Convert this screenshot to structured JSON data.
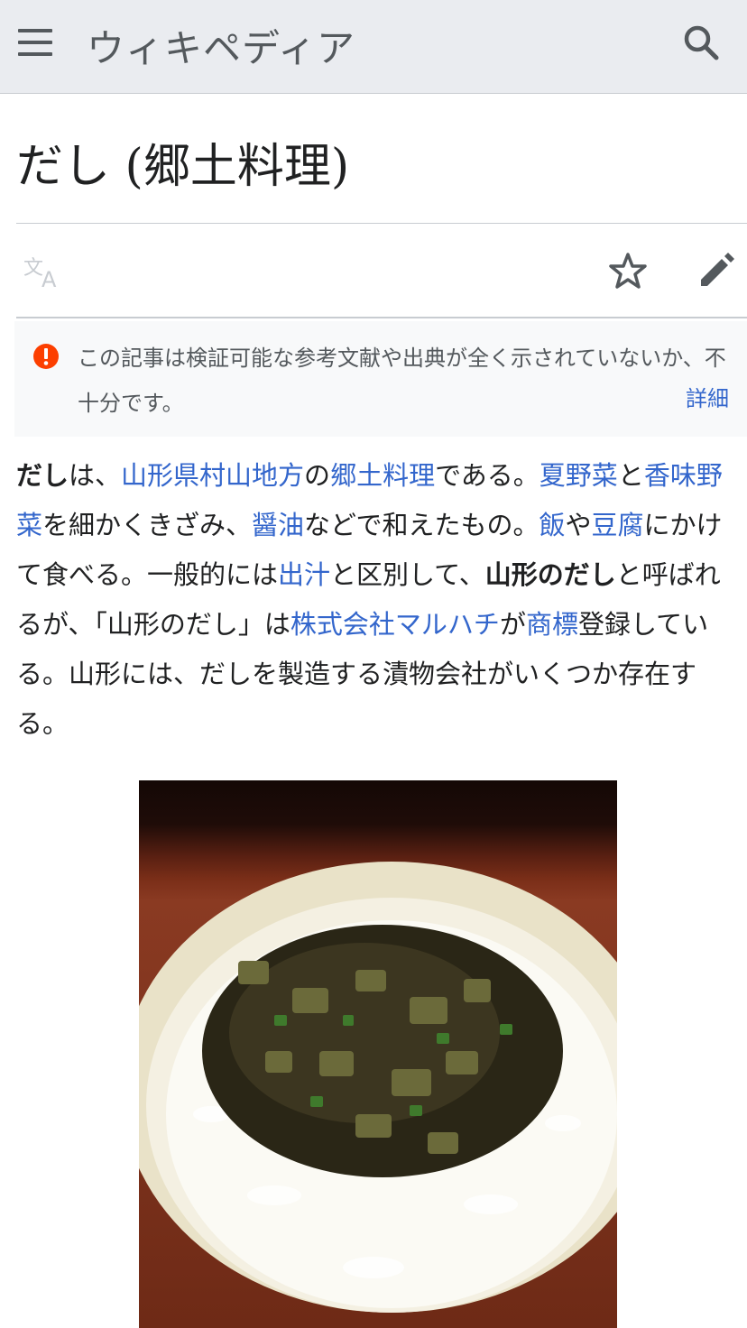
{
  "header": {
    "site_name": "ウィキペディア",
    "menu_icon": "hamburger-menu-icon",
    "search_icon": "search-icon"
  },
  "page": {
    "title": "だし (郷土料理)"
  },
  "toolbar": {
    "language_icon": "language-icon",
    "watch_icon": "star-icon",
    "edit_icon": "edit-pencil-icon"
  },
  "notice": {
    "icon": "alert-icon",
    "text": "この記事は検証可能な参考文献や出典が全く示されていないか、不十分です。",
    "details_link": "詳細"
  },
  "article": {
    "p1": {
      "b1": "だし",
      "t1": "は、",
      "l1": "山形県村山地方",
      "t2": "の",
      "l2": "郷土料理",
      "t3": "である。",
      "l3": "夏野菜",
      "t4": "と",
      "l4": "香味野菜",
      "t5": "を細かくきざみ、",
      "l5": "醤油",
      "t6": "などで和えたもの。",
      "l6": "飯",
      "t7": "や",
      "l7": "豆腐",
      "t8": "にかけて食べる。一般的には",
      "l8": "出汁",
      "t9": "と区別して、",
      "b2": "山形のだし",
      "t10": "と呼ばれるが、「山形のだし」は",
      "l9": "株式会社マルハチ",
      "t11": "が",
      "l10": "商標",
      "t12": "登録している。山形には、だしを製造する漬物会社がいくつか存在する。"
    }
  },
  "colors": {
    "header_bg": "#eaecf0",
    "link": "#3366cc",
    "notice_icon": "#fc3f00",
    "text": "#202122"
  }
}
